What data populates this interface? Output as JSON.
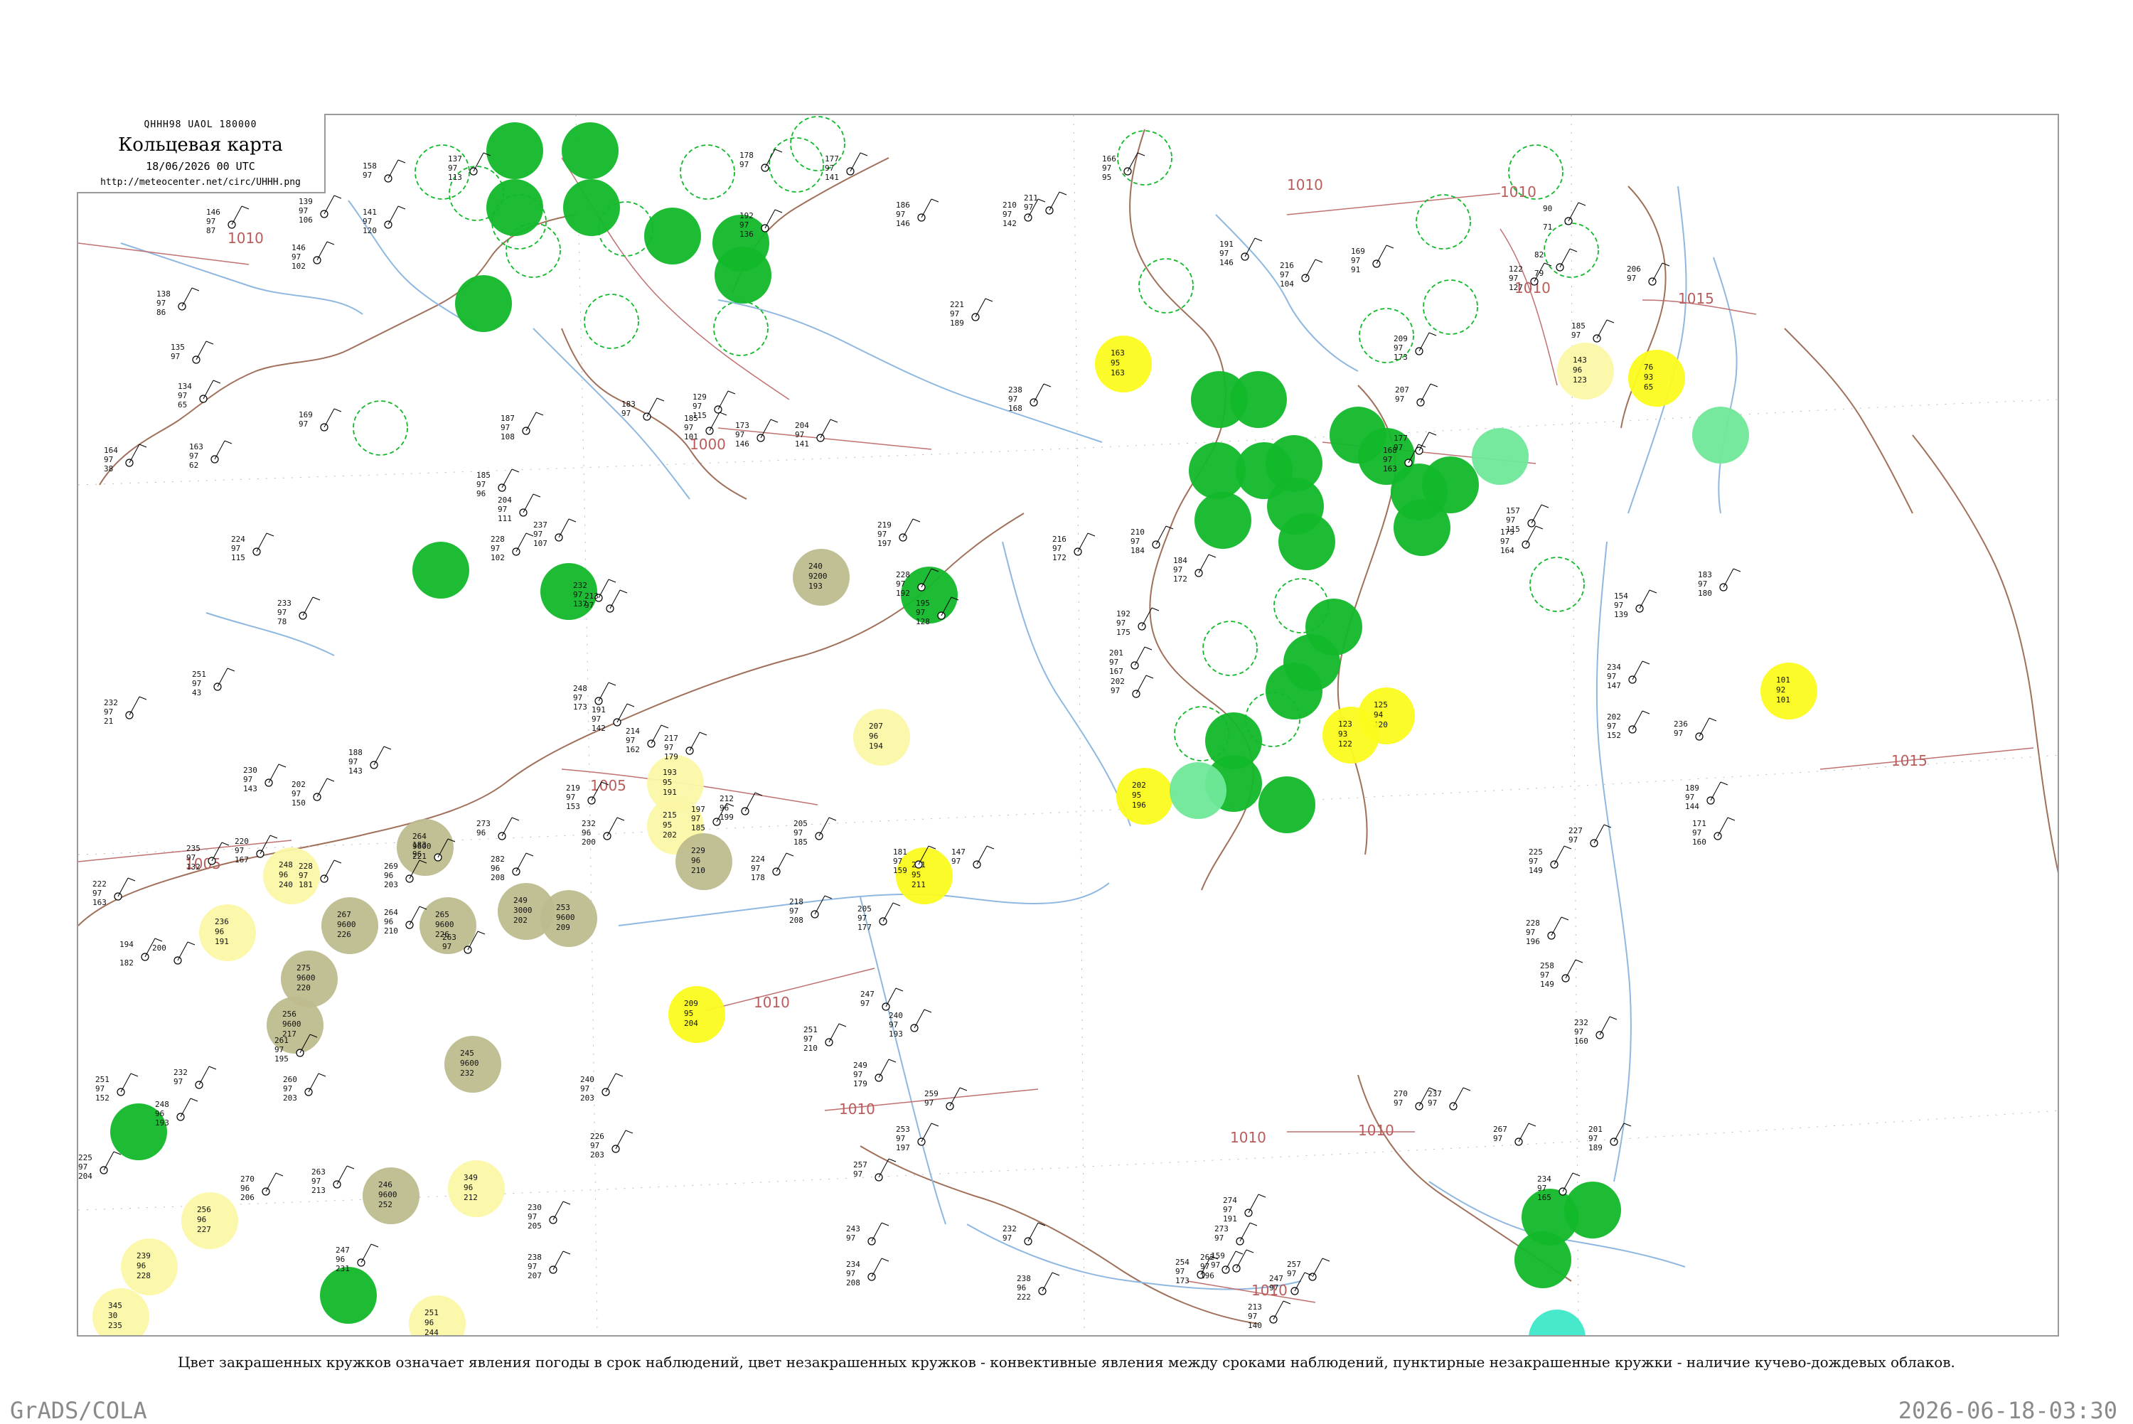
{
  "header": {
    "code": "QHHH98  UAOL  180000",
    "title": "Кольцевая карта",
    "date": "18/06/2026 00 UTC",
    "url": "http://meteocenter.net/circ/UHHH.png"
  },
  "caption": "Цвет закрашенных кружков означает явления погоды в срок наблюдений, цвет незакрашенных кружков - конвективные явления между сроками наблюдений, пунктирные незакрашенные кружки - наличие кучево-дождевых облаков.",
  "footer": {
    "left": "GrADS/COLA",
    "right": "2026-06-18-03:30"
  },
  "colors": {
    "rain_green": "#12b82a",
    "drizzle_yellow": "#fbfb1e",
    "light_yellow": "#fbf7a6",
    "haze_olive": "#bebc8e",
    "shower_light_green": "#6fe89a",
    "thunder_teal": "#3ce8c8",
    "rivers": "#8fb8e0",
    "borders": "#a0705a",
    "isobars": "#c07070"
  },
  "isobars": [
    {
      "label": "1010"
    },
    {
      "label": "1010"
    },
    {
      "label": "1000"
    },
    {
      "label": "1005"
    },
    {
      "label": "1005"
    },
    {
      "label": "1010"
    },
    {
      "label": "1010"
    },
    {
      "label": "1010"
    },
    {
      "label": "1015"
    },
    {
      "label": "1015"
    },
    {
      "label": "1010"
    },
    {
      "label": "1010"
    },
    {
      "label": "1010"
    },
    {
      "label": "1010"
    }
  ],
  "stations": [
    {
      "p": "158",
      "t": "97",
      "d": "",
      "id": ""
    },
    {
      "p": "137",
      "t": "97",
      "d": "113",
      "id": ""
    },
    {
      "p": "146",
      "t": "97",
      "d": "87",
      "id": ""
    },
    {
      "p": "139",
      "t": "97",
      "d": "106",
      "id": ""
    },
    {
      "p": "146",
      "t": "97",
      "d": "102",
      "id": ""
    },
    {
      "p": "141",
      "t": "97",
      "d": "120",
      "id": ""
    },
    {
      "p": "178",
      "t": "97",
      "d": "",
      "id": ""
    },
    {
      "p": "192",
      "t": "97",
      "d": "136",
      "id": ""
    },
    {
      "p": "177",
      "t": "97",
      "d": "141",
      "id": ""
    },
    {
      "p": "186",
      "t": "97",
      "d": "146",
      "id": ""
    },
    {
      "p": "210",
      "t": "97",
      "d": "142",
      "id": ""
    },
    {
      "p": "211",
      "t": "97",
      "d": "",
      "id": ""
    },
    {
      "p": "166",
      "t": "97",
      "d": "95",
      "id": ""
    },
    {
      "p": "90",
      "t": "",
      "d": "71",
      "id": ""
    },
    {
      "p": "191",
      "t": "97",
      "d": "146",
      "id": ""
    },
    {
      "p": "216",
      "t": "97",
      "d": "104",
      "id": ""
    },
    {
      "p": "169",
      "t": "97",
      "d": "91",
      "id": ""
    },
    {
      "p": "138",
      "t": "97",
      "d": "86",
      "id": ""
    },
    {
      "p": "135",
      "t": "97",
      "d": "",
      "id": ""
    },
    {
      "p": "134",
      "t": "97",
      "d": "65",
      "id": ""
    },
    {
      "p": "169",
      "t": "97",
      "d": "",
      "id": ""
    },
    {
      "p": "164",
      "t": "97",
      "d": "38",
      "id": ""
    },
    {
      "p": "163",
      "t": "97",
      "d": "62",
      "id": ""
    },
    {
      "p": "224",
      "t": "97",
      "d": "115",
      "id": ""
    },
    {
      "p": "233",
      "t": "97",
      "d": "78",
      "id": ""
    },
    {
      "p": "251",
      "t": "97",
      "d": "43",
      "id": ""
    },
    {
      "p": "232",
      "t": "97",
      "d": "21",
      "id": ""
    },
    {
      "p": "188",
      "t": "97",
      "d": "143",
      "id": ""
    },
    {
      "p": "230",
      "t": "97",
      "d": "143",
      "id": ""
    },
    {
      "p": "202",
      "t": "97",
      "d": "150",
      "id": ""
    },
    {
      "p": "235",
      "t": "97",
      "d": "132",
      "id": ""
    },
    {
      "p": "222",
      "t": "97",
      "d": "163",
      "id": ""
    },
    {
      "p": "220",
      "t": "97",
      "d": "167",
      "id": ""
    },
    {
      "p": "228",
      "t": "97",
      "d": "181",
      "id": ""
    },
    {
      "p": "194",
      "t": "",
      "d": "182",
      "id": ""
    },
    {
      "p": "200",
      "t": "",
      "d": "",
      "id": ""
    },
    {
      "p": "251",
      "t": "97",
      "d": "152",
      "id": ""
    },
    {
      "p": "232",
      "t": "97",
      "d": "",
      "id": ""
    },
    {
      "p": "248",
      "t": "96",
      "d": "193",
      "id": ""
    },
    {
      "p": "225",
      "t": "97",
      "d": "204",
      "id": ""
    },
    {
      "p": "270",
      "t": "96",
      "d": "206",
      "id": ""
    },
    {
      "p": "260",
      "t": "97",
      "d": "203",
      "id": ""
    },
    {
      "p": "261",
      "t": "97",
      "d": "195",
      "id": ""
    },
    {
      "p": "263",
      "t": "97",
      "d": "213",
      "id": ""
    },
    {
      "p": "247",
      "t": "96",
      "d": "231",
      "id": ""
    },
    {
      "p": "230",
      "t": "97",
      "d": "205",
      "id": ""
    },
    {
      "p": "238",
      "t": "97",
      "d": "207",
      "id": ""
    },
    {
      "p": "240",
      "t": "97",
      "d": "203",
      "id": ""
    },
    {
      "p": "226",
      "t": "97",
      "d": "203",
      "id": ""
    },
    {
      "p": "232",
      "t": "96",
      "d": "200",
      "id": ""
    },
    {
      "p": "197",
      "t": "97",
      "d": "185",
      "id": ""
    },
    {
      "p": "212",
      "t": "96",
      "d": "199",
      "id": ""
    },
    {
      "p": "205",
      "t": "97",
      "d": "185",
      "id": ""
    },
    {
      "p": "224",
      "t": "97",
      "d": "178",
      "id": ""
    },
    {
      "p": "181",
      "t": "97",
      "d": "159",
      "id": ""
    },
    {
      "p": "147",
      "t": "97",
      "d": "",
      "id": ""
    },
    {
      "p": "218",
      "t": "97",
      "d": "208",
      "id": ""
    },
    {
      "p": "205",
      "t": "97",
      "d": "177",
      "id": ""
    },
    {
      "p": "247",
      "t": "97",
      "d": "",
      "id": ""
    },
    {
      "p": "251",
      "t": "97",
      "d": "210",
      "id": ""
    },
    {
      "p": "249",
      "t": "97",
      "d": "179",
      "id": ""
    },
    {
      "p": "240",
      "t": "97",
      "d": "193",
      "id": ""
    },
    {
      "p": "259",
      "t": "97",
      "d": "",
      "id": ""
    },
    {
      "p": "253",
      "t": "97",
      "d": "197",
      "id": ""
    },
    {
      "p": "257",
      "t": "97",
      "d": "",
      "id": ""
    },
    {
      "p": "243",
      "t": "97",
      "d": "",
      "id": ""
    },
    {
      "p": "234",
      "t": "97",
      "d": "208",
      "id": ""
    },
    {
      "p": "238",
      "t": "96",
      "d": "222",
      "id": ""
    },
    {
      "p": "232",
      "t": "97",
      "d": "",
      "id": ""
    },
    {
      "p": "202",
      "t": "97",
      "d": "",
      "id": ""
    },
    {
      "p": "201",
      "t": "97",
      "d": "167",
      "id": ""
    },
    {
      "p": "192",
      "t": "97",
      "d": "175",
      "id": ""
    },
    {
      "p": "184",
      "t": "97",
      "d": "172",
      "id": ""
    },
    {
      "p": "210",
      "t": "97",
      "d": "184",
      "id": ""
    },
    {
      "p": "216",
      "t": "97",
      "d": "172",
      "id": ""
    },
    {
      "p": "227",
      "t": "97",
      "d": "",
      "id": ""
    },
    {
      "p": "225",
      "t": "97",
      "d": "149",
      "id": ""
    },
    {
      "p": "228",
      "t": "97",
      "d": "196",
      "id": ""
    },
    {
      "p": "258",
      "t": "97",
      "d": "149",
      "id": ""
    },
    {
      "p": "232",
      "t": "97",
      "d": "160",
      "id": ""
    },
    {
      "p": "201",
      "t": "97",
      "d": "189",
      "id": ""
    },
    {
      "p": "234",
      "t": "97",
      "d": "165",
      "id": ""
    },
    {
      "p": "237",
      "t": "97",
      "d": "",
      "id": ""
    },
    {
      "p": "270",
      "t": "97",
      "d": "",
      "id": ""
    },
    {
      "p": "267",
      "t": "97",
      "d": "",
      "id": ""
    },
    {
      "p": "274",
      "t": "97",
      "d": "191",
      "id": ""
    },
    {
      "p": "273",
      "t": "97",
      "d": "",
      "id": ""
    },
    {
      "p": "254",
      "t": "97",
      "d": "173",
      "id": ""
    },
    {
      "p": "159",
      "t": "97",
      "d": "",
      "id": ""
    },
    {
      "p": "262",
      "t": "97",
      "d": "196",
      "id": ""
    },
    {
      "p": "257",
      "t": "97",
      "d": "",
      "id": ""
    },
    {
      "p": "247",
      "t": "97",
      "d": "",
      "id": ""
    },
    {
      "p": "213",
      "t": "97",
      "d": "140",
      "id": ""
    },
    {
      "p": "234",
      "t": "97",
      "d": "147",
      "id": ""
    },
    {
      "p": "202",
      "t": "97",
      "d": "152",
      "id": ""
    },
    {
      "p": "236",
      "t": "97",
      "d": "",
      "id": ""
    },
    {
      "p": "189",
      "t": "97",
      "d": "144",
      "id": ""
    },
    {
      "p": "171",
      "t": "97",
      "d": "160",
      "id": ""
    },
    {
      "p": "175",
      "t": "97",
      "d": "164",
      "id": ""
    },
    {
      "p": "157",
      "t": "97",
      "d": "115",
      "id": ""
    },
    {
      "p": "154",
      "t": "97",
      "d": "139",
      "id": ""
    },
    {
      "p": "183",
      "t": "97",
      "d": "180",
      "id": ""
    },
    {
      "p": "185",
      "t": "97",
      "d": "",
      "id": ""
    },
    {
      "p": "122",
      "t": "97",
      "d": "127",
      "id": ""
    },
    {
      "p": "82",
      "t": "",
      "d": "79",
      "id": ""
    },
    {
      "p": "206",
      "t": "97",
      "d": "",
      "id": ""
    },
    {
      "p": "209",
      "t": "97",
      "d": "173",
      "id": ""
    },
    {
      "p": "207",
      "t": "97",
      "d": "",
      "id": ""
    },
    {
      "p": "177",
      "t": "97",
      "d": "",
      "id": ""
    },
    {
      "p": "168",
      "t": "97",
      "d": "163",
      "id": ""
    },
    {
      "p": "221",
      "t": "97",
      "d": "189",
      "id": ""
    },
    {
      "p": "238",
      "t": "97",
      "d": "168",
      "id": ""
    },
    {
      "p": "219",
      "t": "97",
      "d": "197",
      "id": ""
    },
    {
      "p": "228",
      "t": "97",
      "d": "192",
      "id": ""
    },
    {
      "p": "195",
      "t": "97",
      "d": "128",
      "id": ""
    },
    {
      "p": "129",
      "t": "97",
      "d": "115",
      "id": ""
    },
    {
      "p": "173",
      "t": "97",
      "d": "146",
      "id": ""
    },
    {
      "p": "204",
      "t": "97",
      "d": "141",
      "id": ""
    },
    {
      "p": "185",
      "t": "97",
      "d": "101",
      "id": ""
    },
    {
      "p": "183",
      "t": "97",
      "d": "",
      "id": ""
    },
    {
      "p": "187",
      "t": "97",
      "d": "108",
      "id": ""
    },
    {
      "p": "185",
      "t": "97",
      "d": "96",
      "id": ""
    },
    {
      "p": "204",
      "t": "97",
      "d": "111",
      "id": ""
    },
    {
      "p": "228",
      "t": "97",
      "d": "102",
      "id": ""
    },
    {
      "p": "237",
      "t": "97",
      "d": "107",
      "id": ""
    },
    {
      "p": "232",
      "t": "97",
      "d": "137",
      "id": ""
    },
    {
      "p": "213",
      "t": "97",
      "d": "",
      "id": ""
    },
    {
      "p": "248",
      "t": "97",
      "d": "173",
      "id": ""
    },
    {
      "p": "191",
      "t": "97",
      "d": "142",
      "id": ""
    },
    {
      "p": "214",
      "t": "97",
      "d": "162",
      "id": ""
    },
    {
      "p": "217",
      "t": "97",
      "d": "179",
      "id": ""
    },
    {
      "p": "219",
      "t": "97",
      "d": "153",
      "id": ""
    },
    {
      "p": "273",
      "t": "96",
      "d": "",
      "id": ""
    },
    {
      "p": "282",
      "t": "96",
      "d": "208",
      "id": ""
    },
    {
      "p": "183",
      "t": "96",
      "d": "",
      "id": ""
    },
    {
      "p": "269",
      "t": "96",
      "d": "203",
      "id": ""
    },
    {
      "p": "263",
      "t": "97",
      "d": "",
      "id": ""
    },
    {
      "p": "264",
      "t": "96",
      "d": "210",
      "id": ""
    }
  ],
  "weather_circles": [
    {
      "p": "",
      "t": "",
      "d": ""
    },
    {
      "p": "",
      "t": "",
      "d": ""
    },
    {
      "p": "",
      "t": "",
      "d": ""
    },
    {
      "p": "",
      "t": "",
      "d": ""
    },
    {
      "p": "",
      "t": "",
      "d": ""
    },
    {
      "p": "",
      "t": "",
      "d": ""
    },
    {
      "p": "",
      "t": "",
      "d": ""
    },
    {
      "p": "",
      "t": "",
      "d": ""
    },
    {
      "p": "",
      "t": "",
      "d": ""
    },
    {
      "p": "",
      "t": "",
      "d": ""
    },
    {
      "p": "",
      "t": "",
      "d": ""
    },
    {
      "p": "",
      "t": "",
      "d": ""
    },
    {
      "p": "",
      "t": "",
      "d": ""
    },
    {
      "p": "",
      "t": "",
      "d": ""
    },
    {
      "p": "",
      "t": "",
      "d": ""
    },
    {
      "p": "",
      "t": "",
      "d": ""
    },
    {
      "p": "",
      "t": "",
      "d": ""
    },
    {
      "p": "",
      "t": "",
      "d": ""
    },
    {
      "p": "",
      "t": "",
      "d": ""
    },
    {
      "p": "",
      "t": "",
      "d": ""
    },
    {
      "p": "",
      "t": "",
      "d": ""
    },
    {
      "p": "",
      "t": "",
      "d": ""
    },
    {
      "p": "",
      "t": "",
      "d": ""
    },
    {
      "p": "",
      "t": "",
      "d": ""
    },
    {
      "p": "",
      "t": "",
      "d": ""
    },
    {
      "p": "",
      "t": "",
      "d": ""
    },
    {
      "p": "",
      "t": "",
      "d": ""
    },
    {
      "p": "",
      "t": "",
      "d": ""
    },
    {
      "p": "",
      "t": "",
      "d": ""
    },
    {
      "p": "",
      "t": "",
      "d": ""
    },
    {
      "p": "",
      "t": "",
      "d": ""
    },
    {
      "p": "",
      "t": "",
      "d": ""
    },
    {
      "p": "",
      "t": "",
      "d": ""
    },
    {
      "p": "",
      "t": "",
      "d": ""
    },
    {
      "p": "",
      "t": "",
      "d": ""
    },
    {
      "p": "163",
      "t": "95",
      "d": "163"
    },
    {
      "p": "202",
      "t": "95",
      "d": "196"
    },
    {
      "p": "125",
      "t": "94",
      "d": "120"
    },
    {
      "p": "123",
      "t": "93",
      "d": "122"
    },
    {
      "p": "101",
      "t": "92",
      "d": "101"
    },
    {
      "p": "76",
      "t": "93",
      "d": "65"
    },
    {
      "p": "193",
      "t": "95",
      "d": "191"
    },
    {
      "p": "215",
      "t": "95",
      "d": "202"
    },
    {
      "p": "211",
      "t": "95",
      "d": "211"
    },
    {
      "p": "209",
      "t": "95",
      "d": "204"
    },
    {
      "p": "143",
      "t": "96",
      "d": "123"
    },
    {
      "p": "207",
      "t": "96",
      "d": "194"
    },
    {
      "p": "248",
      "t": "96",
      "d": "240"
    },
    {
      "p": "236",
      "t": "96",
      "d": "191"
    },
    {
      "p": "256",
      "t": "96",
      "d": "227"
    },
    {
      "p": "239",
      "t": "96",
      "d": "228"
    },
    {
      "p": "345",
      "t": "30",
      "d": "235"
    },
    {
      "p": "349",
      "t": "96",
      "d": "212"
    },
    {
      "p": "251",
      "t": "96",
      "d": "244"
    },
    {
      "p": "240",
      "t": "9200",
      "d": "193"
    },
    {
      "p": "229",
      "t": "96",
      "d": "210"
    },
    {
      "p": "264",
      "t": "9600",
      "d": "221"
    },
    {
      "p": "267",
      "t": "9600",
      "d": "226"
    },
    {
      "p": "265",
      "t": "9600",
      "d": "226"
    },
    {
      "p": "249",
      "t": "3000",
      "d": "202"
    },
    {
      "p": "253",
      "t": "9600",
      "d": "209"
    },
    {
      "p": "275",
      "t": "9600",
      "d": "220"
    },
    {
      "p": "256",
      "t": "9600",
      "d": "217"
    },
    {
      "p": "245",
      "t": "9600",
      "d": "232"
    },
    {
      "p": "246",
      "t": "9600",
      "d": "252"
    },
    {
      "p": "",
      "t": "",
      "d": ""
    },
    {
      "p": "",
      "t": "",
      "d": ""
    },
    {
      "p": "",
      "t": "",
      "d": ""
    },
    {
      "p": "",
      "t": "",
      "d": ""
    }
  ]
}
